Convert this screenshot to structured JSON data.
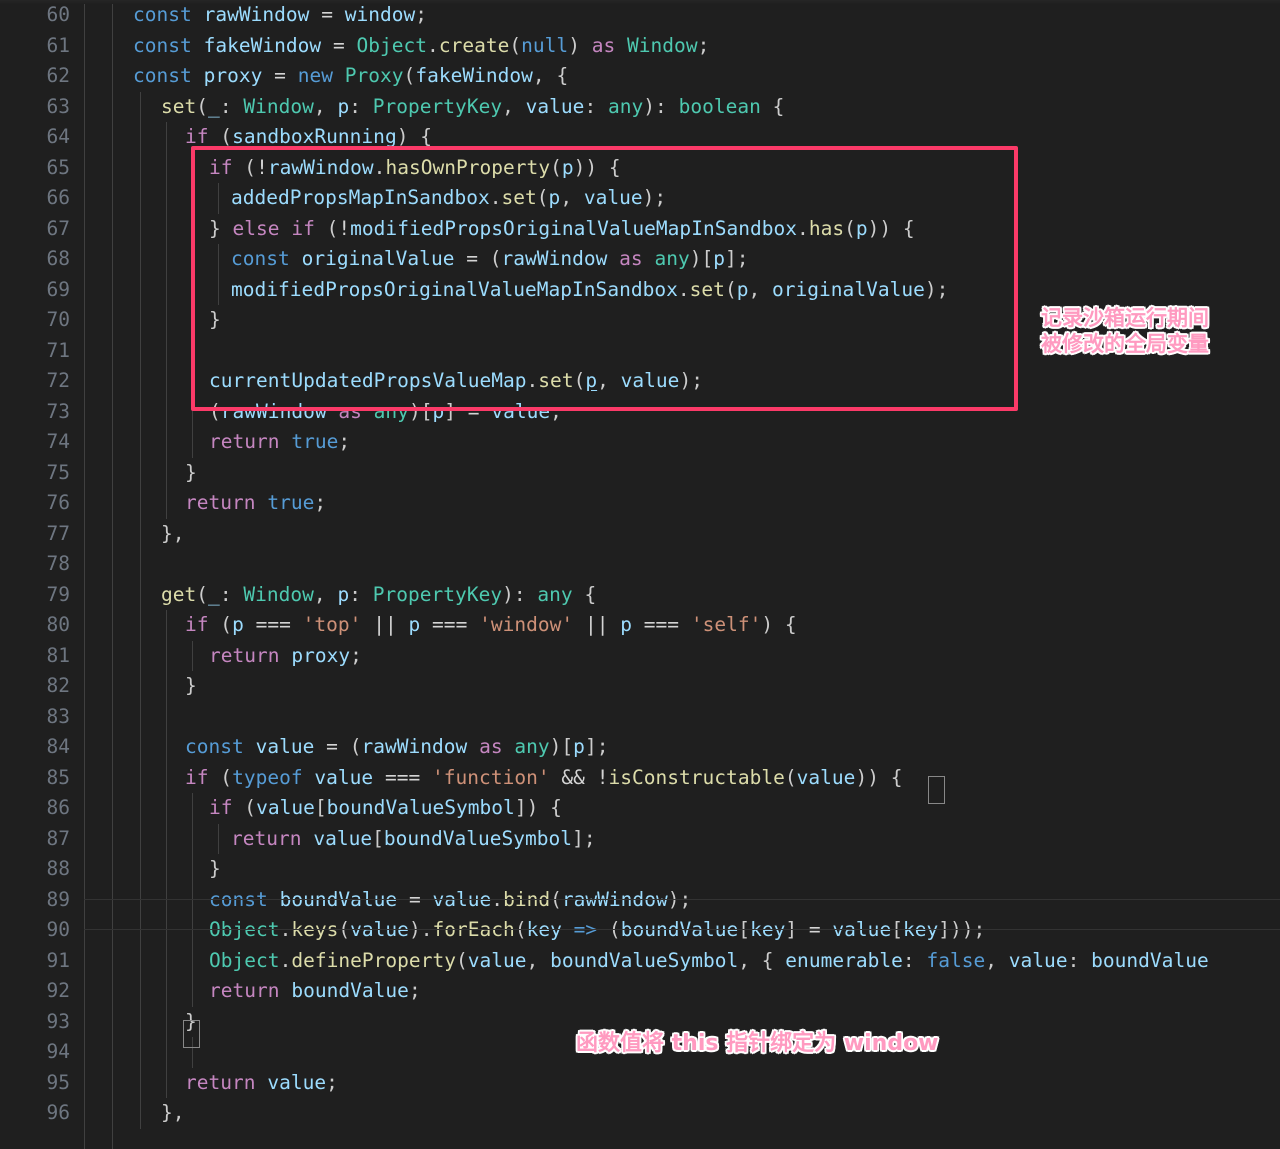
{
  "editor": {
    "kind": "code-editor",
    "language": "typescript",
    "first_visible_line": 60,
    "last_visible_line": 96,
    "background_color": "#1f1f1f",
    "line_number_color": "#6e7681",
    "indent_guide_color": "#404040"
  },
  "colors": {
    "highlight_box_border": "#fb3a68",
    "annotation_text": "#ff9ac0",
    "annotation_outline": "#ffffff",
    "keyword": "#c586c0",
    "storage": "#569cd6",
    "type": "#4ec9b0",
    "function": "#dcdcaa",
    "variable": "#9cdcfe",
    "string": "#ce9178",
    "punctuation": "#cccccc"
  },
  "annotations": [
    {
      "id": "record-modified-globals",
      "text_line_1": "记录沙箱运行期间",
      "text_line_2": "被修改的全局变量",
      "position": "right-of-highlight-box"
    },
    {
      "id": "bind-this-to-window",
      "text": "函数值将 this 指针绑定为 window",
      "position": "below-line-93"
    }
  ],
  "highlight_box": {
    "covers_lines": [
      65,
      72
    ],
    "border_color": "#fb3a68",
    "border_width_px": 4
  },
  "lines": [
    {
      "number": "60",
      "text": "    const rawWindow = window;"
    },
    {
      "number": "61",
      "text": "    const fakeWindow = Object.create(null) as Window;"
    },
    {
      "number": "62",
      "text": "    const proxy = new Proxy(fakeWindow, {"
    },
    {
      "number": "63",
      "text": "      set(_: Window, p: PropertyKey, value: any): boolean {"
    },
    {
      "number": "64",
      "text": "        if (sandboxRunning) {"
    },
    {
      "number": "65",
      "text": "          if (!rawWindow.hasOwnProperty(p)) {"
    },
    {
      "number": "66",
      "text": "            addedPropsMapInSandbox.set(p, value);"
    },
    {
      "number": "67",
      "text": "          } else if (!modifiedPropsOriginalValueMapInSandbox.has(p)) {"
    },
    {
      "number": "68",
      "text": "            const originalValue = (rawWindow as any)[p];"
    },
    {
      "number": "69",
      "text": "            modifiedPropsOriginalValueMapInSandbox.set(p, originalValue);"
    },
    {
      "number": "70",
      "text": "          }"
    },
    {
      "number": "71",
      "text": ""
    },
    {
      "number": "72",
      "text": "          currentUpdatedPropsValueMap.set(p, value);"
    },
    {
      "number": "73",
      "text": "          (rawWindow as any)[p] = value;"
    },
    {
      "number": "74",
      "text": "          return true;"
    },
    {
      "number": "75",
      "text": "        }"
    },
    {
      "number": "76",
      "text": "        return true;"
    },
    {
      "number": "77",
      "text": "      },"
    },
    {
      "number": "78",
      "text": ""
    },
    {
      "number": "79",
      "text": "      get(_: Window, p: PropertyKey): any {"
    },
    {
      "number": "80",
      "text": "        if (p === 'top' || p === 'window' || p === 'self') {"
    },
    {
      "number": "81",
      "text": "          return proxy;"
    },
    {
      "number": "82",
      "text": "        }"
    },
    {
      "number": "83",
      "text": ""
    },
    {
      "number": "84",
      "text": "        const value = (rawWindow as any)[p];"
    },
    {
      "number": "85",
      "text": "        if (typeof value === 'function' && !isConstructable(value)) {"
    },
    {
      "number": "86",
      "text": "          if (value[boundValueSymbol]) {"
    },
    {
      "number": "87",
      "text": "            return value[boundValueSymbol];"
    },
    {
      "number": "88",
      "text": "          }"
    },
    {
      "number": "89",
      "text": "          const boundValue = value.bind(rawWindow);"
    },
    {
      "number": "90",
      "text": "          Object.keys(value).forEach(key => (boundValue[key] = value[key]));"
    },
    {
      "number": "91",
      "text": "          Object.defineProperty(value, boundValueSymbol, { enumerable: false, value: boundValue"
    },
    {
      "number": "92",
      "text": "          return boundValue;"
    },
    {
      "number": "93",
      "text": "        }"
    },
    {
      "number": "94",
      "text": ""
    },
    {
      "number": "95",
      "text": "        return value;"
    },
    {
      "number": "96",
      "text": "      },"
    }
  ]
}
